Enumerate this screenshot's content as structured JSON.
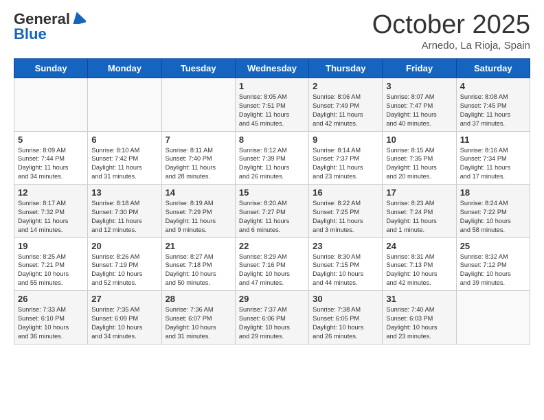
{
  "header": {
    "logo_general": "General",
    "logo_blue": "Blue",
    "month_title": "October 2025",
    "location": "Arnedo, La Rioja, Spain"
  },
  "days_of_week": [
    "Sunday",
    "Monday",
    "Tuesday",
    "Wednesday",
    "Thursday",
    "Friday",
    "Saturday"
  ],
  "weeks": [
    [
      {
        "day": "",
        "info": ""
      },
      {
        "day": "",
        "info": ""
      },
      {
        "day": "",
        "info": ""
      },
      {
        "day": "1",
        "info": "Sunrise: 8:05 AM\nSunset: 7:51 PM\nDaylight: 11 hours\nand 45 minutes."
      },
      {
        "day": "2",
        "info": "Sunrise: 8:06 AM\nSunset: 7:49 PM\nDaylight: 11 hours\nand 42 minutes."
      },
      {
        "day": "3",
        "info": "Sunrise: 8:07 AM\nSunset: 7:47 PM\nDaylight: 11 hours\nand 40 minutes."
      },
      {
        "day": "4",
        "info": "Sunrise: 8:08 AM\nSunset: 7:45 PM\nDaylight: 11 hours\nand 37 minutes."
      }
    ],
    [
      {
        "day": "5",
        "info": "Sunrise: 8:09 AM\nSunset: 7:44 PM\nDaylight: 11 hours\nand 34 minutes."
      },
      {
        "day": "6",
        "info": "Sunrise: 8:10 AM\nSunset: 7:42 PM\nDaylight: 11 hours\nand 31 minutes."
      },
      {
        "day": "7",
        "info": "Sunrise: 8:11 AM\nSunset: 7:40 PM\nDaylight: 11 hours\nand 28 minutes."
      },
      {
        "day": "8",
        "info": "Sunrise: 8:12 AM\nSunset: 7:39 PM\nDaylight: 11 hours\nand 26 minutes."
      },
      {
        "day": "9",
        "info": "Sunrise: 8:14 AM\nSunset: 7:37 PM\nDaylight: 11 hours\nand 23 minutes."
      },
      {
        "day": "10",
        "info": "Sunrise: 8:15 AM\nSunset: 7:35 PM\nDaylight: 11 hours\nand 20 minutes."
      },
      {
        "day": "11",
        "info": "Sunrise: 8:16 AM\nSunset: 7:34 PM\nDaylight: 11 hours\nand 17 minutes."
      }
    ],
    [
      {
        "day": "12",
        "info": "Sunrise: 8:17 AM\nSunset: 7:32 PM\nDaylight: 11 hours\nand 14 minutes."
      },
      {
        "day": "13",
        "info": "Sunrise: 8:18 AM\nSunset: 7:30 PM\nDaylight: 11 hours\nand 12 minutes."
      },
      {
        "day": "14",
        "info": "Sunrise: 8:19 AM\nSunset: 7:29 PM\nDaylight: 11 hours\nand 9 minutes."
      },
      {
        "day": "15",
        "info": "Sunrise: 8:20 AM\nSunset: 7:27 PM\nDaylight: 11 hours\nand 6 minutes."
      },
      {
        "day": "16",
        "info": "Sunrise: 8:22 AM\nSunset: 7:25 PM\nDaylight: 11 hours\nand 3 minutes."
      },
      {
        "day": "17",
        "info": "Sunrise: 8:23 AM\nSunset: 7:24 PM\nDaylight: 11 hours\nand 1 minute."
      },
      {
        "day": "18",
        "info": "Sunrise: 8:24 AM\nSunset: 7:22 PM\nDaylight: 10 hours\nand 58 minutes."
      }
    ],
    [
      {
        "day": "19",
        "info": "Sunrise: 8:25 AM\nSunset: 7:21 PM\nDaylight: 10 hours\nand 55 minutes."
      },
      {
        "day": "20",
        "info": "Sunrise: 8:26 AM\nSunset: 7:19 PM\nDaylight: 10 hours\nand 52 minutes."
      },
      {
        "day": "21",
        "info": "Sunrise: 8:27 AM\nSunset: 7:18 PM\nDaylight: 10 hours\nand 50 minutes."
      },
      {
        "day": "22",
        "info": "Sunrise: 8:29 AM\nSunset: 7:16 PM\nDaylight: 10 hours\nand 47 minutes."
      },
      {
        "day": "23",
        "info": "Sunrise: 8:30 AM\nSunset: 7:15 PM\nDaylight: 10 hours\nand 44 minutes."
      },
      {
        "day": "24",
        "info": "Sunrise: 8:31 AM\nSunset: 7:13 PM\nDaylight: 10 hours\nand 42 minutes."
      },
      {
        "day": "25",
        "info": "Sunrise: 8:32 AM\nSunset: 7:12 PM\nDaylight: 10 hours\nand 39 minutes."
      }
    ],
    [
      {
        "day": "26",
        "info": "Sunrise: 7:33 AM\nSunset: 6:10 PM\nDaylight: 10 hours\nand 36 minutes."
      },
      {
        "day": "27",
        "info": "Sunrise: 7:35 AM\nSunset: 6:09 PM\nDaylight: 10 hours\nand 34 minutes."
      },
      {
        "day": "28",
        "info": "Sunrise: 7:36 AM\nSunset: 6:07 PM\nDaylight: 10 hours\nand 31 minutes."
      },
      {
        "day": "29",
        "info": "Sunrise: 7:37 AM\nSunset: 6:06 PM\nDaylight: 10 hours\nand 29 minutes."
      },
      {
        "day": "30",
        "info": "Sunrise: 7:38 AM\nSunset: 6:05 PM\nDaylight: 10 hours\nand 26 minutes."
      },
      {
        "day": "31",
        "info": "Sunrise: 7:40 AM\nSunset: 6:03 PM\nDaylight: 10 hours\nand 23 minutes."
      },
      {
        "day": "",
        "info": ""
      }
    ]
  ]
}
